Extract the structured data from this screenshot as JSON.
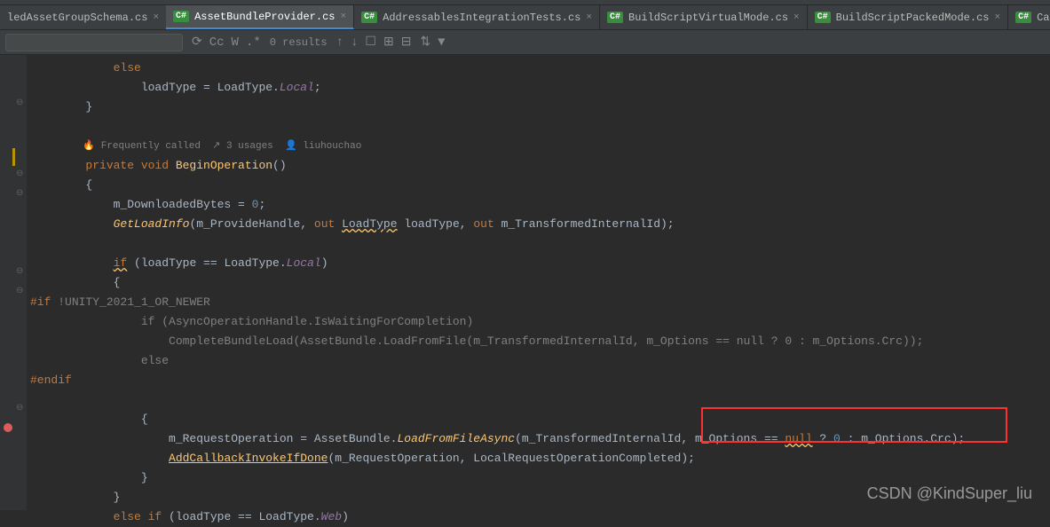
{
  "tabs": [
    {
      "label": "ledAssetGroupSchema.cs",
      "active": false,
      "partial": true
    },
    {
      "label": "AssetBundleProvider.cs",
      "active": true
    },
    {
      "label": "AddressablesIntegrationTests.cs",
      "active": false
    },
    {
      "label": "BuildScriptVirtualMode.cs",
      "active": false
    },
    {
      "label": "BuildScriptPackedMode.cs",
      "active": false
    },
    {
      "label": "Caching.cs",
      "active": false
    }
  ],
  "csIconText": "C#",
  "toolbar": {
    "results": "0 results"
  },
  "hints": {
    "freq": "Frequently called",
    "usages": "3 usages",
    "author": "liuhouchao"
  },
  "code": {
    "l1": "            else",
    "l2_a": "                loadType = LoadType.",
    "l2_b": "Local",
    "l2_c": ";",
    "l3": "        }",
    "l4_a": "        private void ",
    "l4_b": "BeginOperation",
    "l4_c": "()",
    "l5": "        {",
    "l6_a": "            m_DownloadedBytes = ",
    "l6_b": "0",
    "l6_c": ";",
    "l7_a": "            ",
    "l7_b": "GetLoadInfo",
    "l7_c": "(m_ProvideHandle, ",
    "l7_d": "out ",
    "l7_e": "LoadType",
    "l7_f": " loadType, ",
    "l7_g": "out ",
    "l7_h": "m_TransformedInternalId);",
    "l8_a": "            ",
    "l8_b": "if",
    "l8_c": " (loadType == LoadType.",
    "l8_d": "Local",
    "l8_e": ")",
    "l9": "            {",
    "l10_a": "#if ",
    "l10_b": "!UNITY_2021_1_OR_NEWER",
    "l11_a": "                if (AsyncOperationHandle.IsWaitingForCompletion)",
    "l12_a": "                    CompleteBundleLoad(AssetBundle.LoadFromFile(m_TransformedInternalId, m_Options == null ? 0 : m_Options.Crc));",
    "l13_a": "                else",
    "l14": "#endif",
    "l15": "                {",
    "l16_a": "                    m_RequestOperation = AssetBundle.",
    "l16_b": "LoadFromFileAsync",
    "l16_c": "(m_TransformedInternalId,",
    "l16_d": " m_Options == ",
    "l16_e": "null",
    "l16_f": " ? ",
    "l16_g": "0",
    "l16_h": " : m_Options.Crc);",
    "l17_a": "                    ",
    "l17_b": "AddCallbackInvokeIfDone",
    "l17_c": "(m_RequestOperation, LocalRequestOperationCompleted);",
    "l18": "                }",
    "l19": "            }",
    "l20_a": "            ",
    "l20_b": "else if",
    "l20_c": " (loadType == LoadType.",
    "l20_d": "Web",
    "l20_e": ")"
  },
  "watermark": "CSDN @KindSuper_liu"
}
